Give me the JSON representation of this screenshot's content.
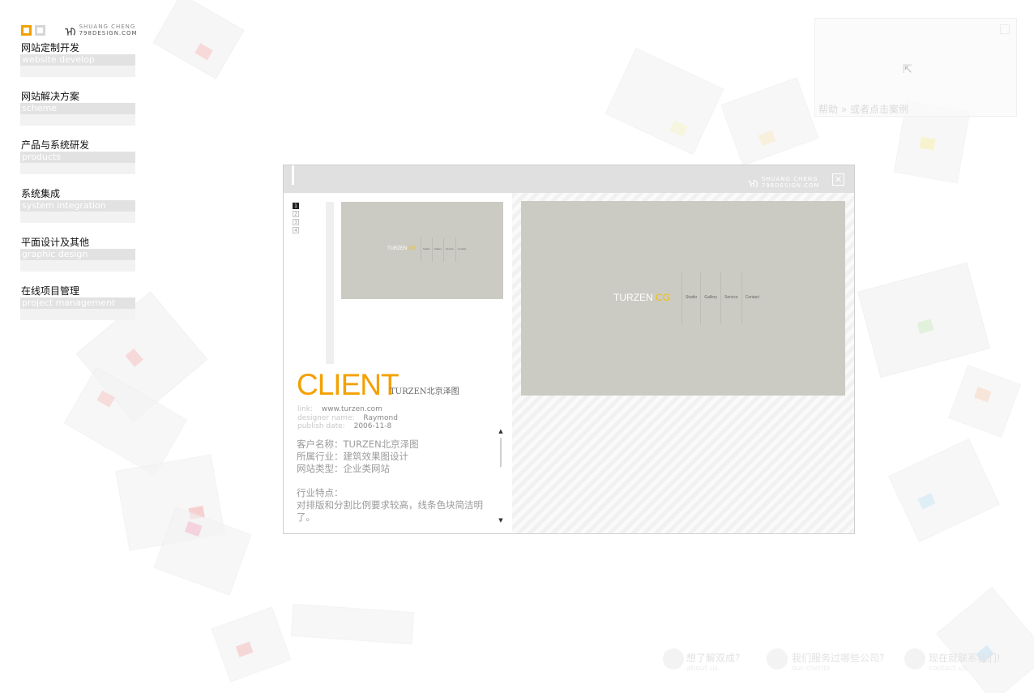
{
  "logo": {
    "mark": "℡",
    "line1": "SHUANG CHENG",
    "line2": "798DESIGN.COM"
  },
  "menu": [
    {
      "cn": "网站定制开发",
      "en": "website develop"
    },
    {
      "cn": "网站解决方案",
      "en": "scheme"
    },
    {
      "cn": "产品与系统研发",
      "en": "products"
    },
    {
      "cn": "系统集成",
      "en": "system integration"
    },
    {
      "cn": "平面设计及其他",
      "en": "graphic design"
    },
    {
      "cn": "在线项目管理",
      "en": "project management"
    }
  ],
  "help": {
    "text": "帮助 » 或者点击案例"
  },
  "modal": {
    "pages": [
      "1",
      "2",
      "3",
      "4"
    ],
    "close_label": "×",
    "client_title": "CLIENT",
    "client_name": "TURZEN北京泽图",
    "meta": {
      "link_label": "link:",
      "link_value": "www.turzen.com",
      "designer_label": "designer name:",
      "designer_value": "Raymond",
      "date_label": "publish date:",
      "date_value": "2006-11-8"
    },
    "description": {
      "customer": "客户名称：TURZEN北京泽图",
      "industry": "所属行业：建筑效果图设计",
      "site_type": "网站类型：企业类网站",
      "feature_title": "行业特点：",
      "feature_text1": "对排版和分割比例要求较高，线条色块简洁明",
      "feature_text2": "了。"
    },
    "scroll_up": "▲",
    "scroll_down": "▼",
    "site": {
      "logo_text": "TURZEN",
      "logo_accent": "CG",
      "nav": [
        "Studio",
        "Gallery",
        "Service",
        "Contact"
      ]
    }
  },
  "bottom_links": [
    {
      "label": "想了解双成?",
      "sub": "about us"
    },
    {
      "label": "我们服务过哪些公司?",
      "sub": "our clients"
    },
    {
      "label": "现在就联系我们!",
      "sub": "contact us"
    }
  ],
  "colors": {
    "accent": "#f4a000",
    "menu_en_bg": "#e2e2e2",
    "preview_bg": "#cccbc3",
    "cg_yellow": "#f4c000"
  }
}
